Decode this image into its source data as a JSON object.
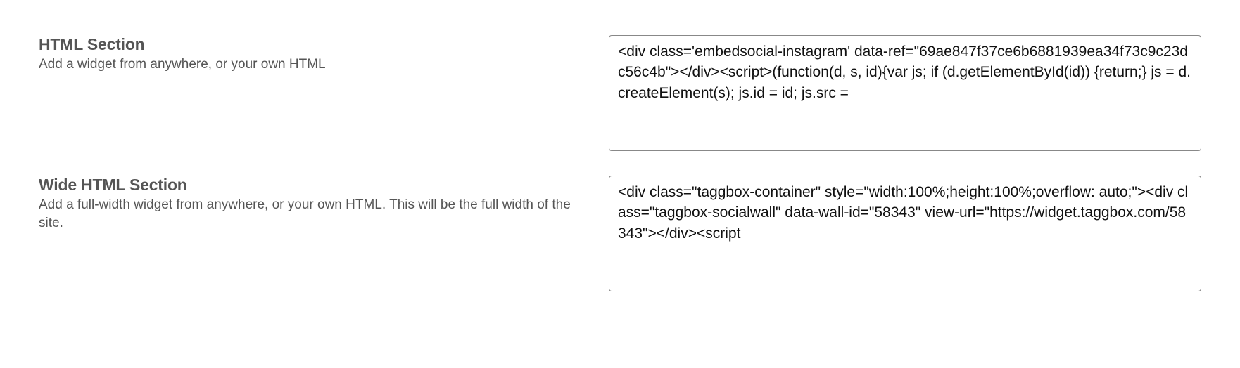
{
  "sections": [
    {
      "title": "HTML Section",
      "description": "Add a widget from anywhere, or your own HTML",
      "value": "<div class='embedsocial-instagram' data-ref=\"69ae847f37ce6b6881939ea34f73c9c23dc56c4b\"></div><script>(function(d, s, id){var js; if (d.getElementById(id)) {return;} js = d.createElement(s); js.id = id; js.src ="
    },
    {
      "title": "Wide HTML Section",
      "description": "Add a full-width widget from anywhere, or your own HTML. This will be the full width of the site.",
      "value": "<div class=\"taggbox-container\" style=\"width:100%;height:100%;overflow: auto;\"><div class=\"taggbox-socialwall\" data-wall-id=\"58343\" view-url=\"https://widget.taggbox.com/58343\"></div><script"
    }
  ]
}
